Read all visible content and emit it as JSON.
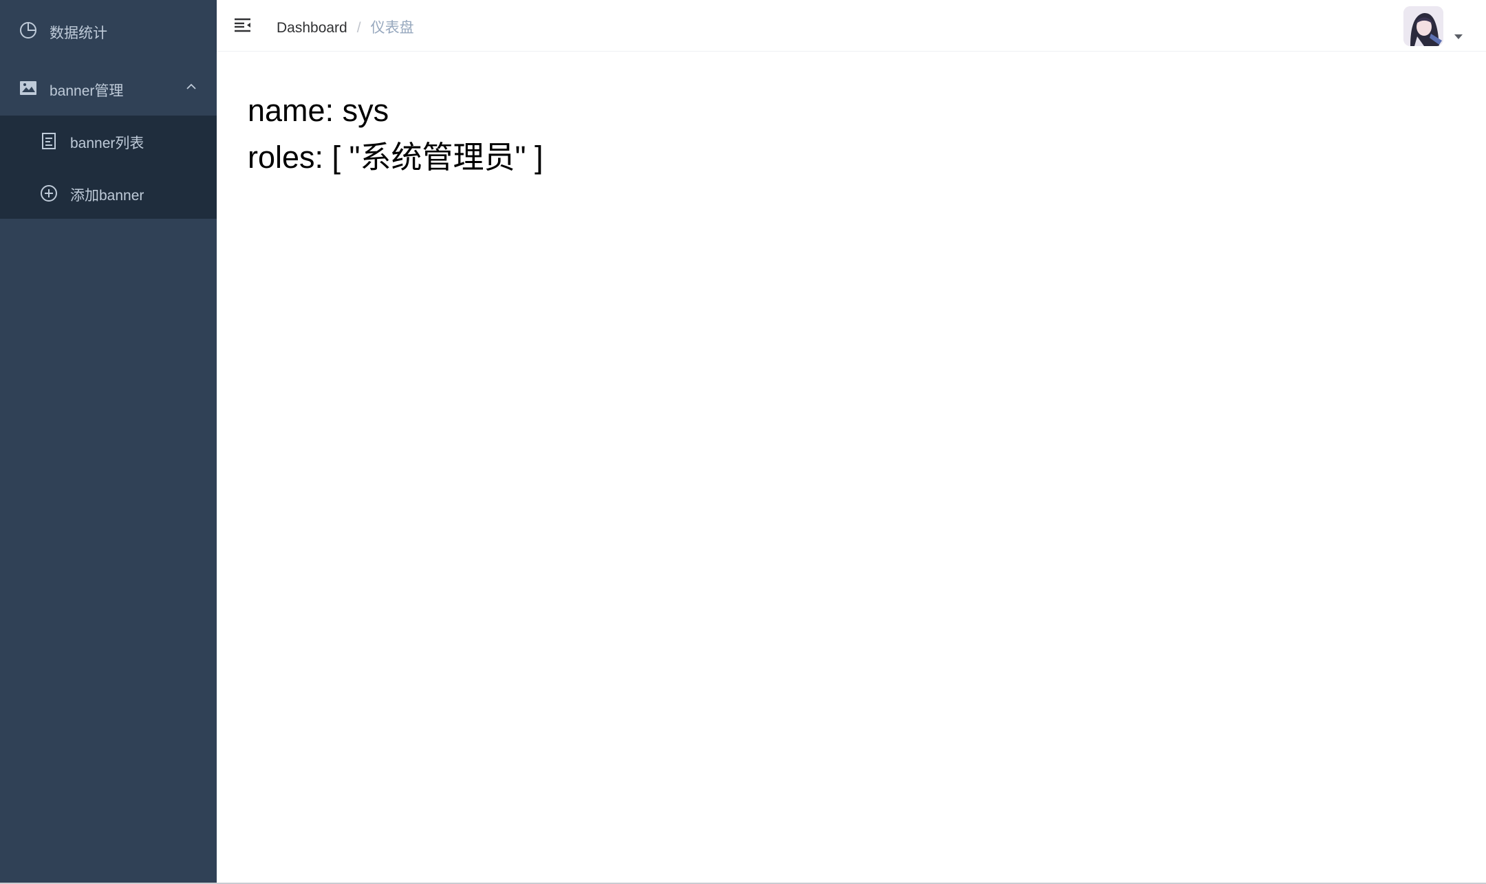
{
  "sidebar": {
    "items": [
      {
        "label": "数据统计",
        "icon": "pie-chart-icon"
      },
      {
        "label": "banner管理",
        "icon": "image-icon",
        "expanded": true,
        "children": [
          {
            "label": "banner列表",
            "icon": "document-icon"
          },
          {
            "label": "添加banner",
            "icon": "circle-plus-icon"
          }
        ]
      }
    ]
  },
  "navbar": {
    "hamburger_icon": "hamburger-fold-icon",
    "breadcrumb": {
      "home": "Dashboard",
      "separator": "/",
      "current": "仪表盘"
    },
    "avatar_icon": "user-avatar",
    "dropdown_icon": "caret-down-icon"
  },
  "main": {
    "name_line": "name: sys",
    "roles_line": "roles: [ \"系统管理员\" ]"
  },
  "colors": {
    "sidebar_bg": "#304156",
    "submenu_bg": "#1f2d3d",
    "sidebar_text": "#bfcbd9",
    "breadcrumb_current": "#97a8be"
  }
}
